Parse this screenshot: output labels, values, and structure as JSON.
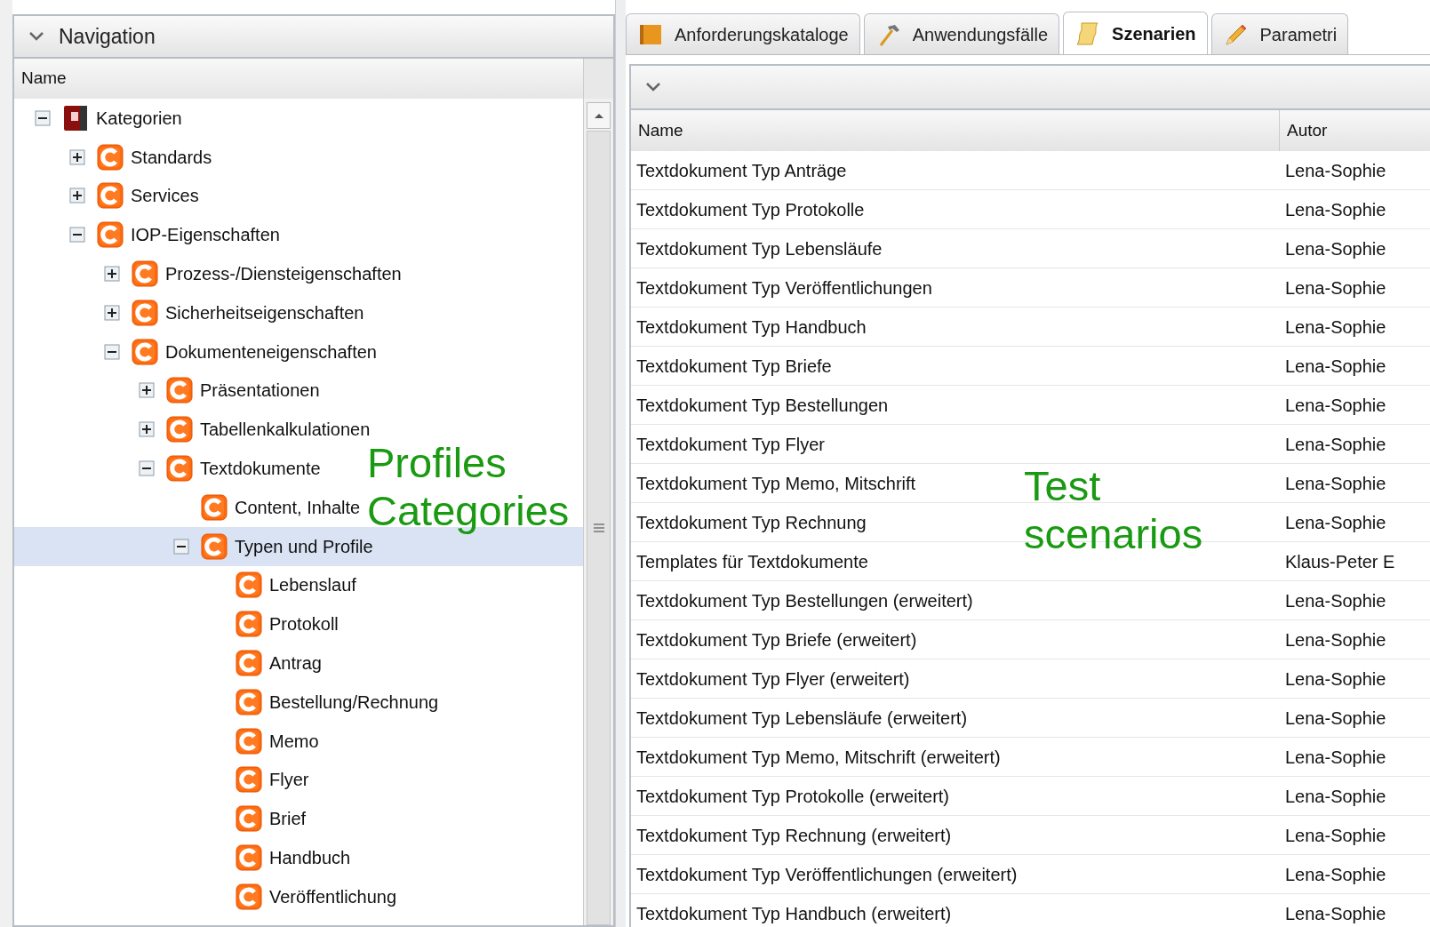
{
  "navigation": {
    "title": "Navigation",
    "expanded": true,
    "column": "Name",
    "tree": [
      {
        "label": "Kategorien",
        "kind": "root",
        "expanded": true,
        "selected": false,
        "children": [
          {
            "label": "Standards",
            "kind": "category",
            "expanded": false,
            "selected": false
          },
          {
            "label": "Services",
            "kind": "category",
            "expanded": false,
            "selected": false
          },
          {
            "label": "IOP-Eigenschaften",
            "kind": "category",
            "expanded": true,
            "selected": false,
            "children": [
              {
                "label": "Prozess-/Diensteigenschaften",
                "kind": "category",
                "expanded": false,
                "selected": false
              },
              {
                "label": "Sicherheitseigenschaften",
                "kind": "category",
                "expanded": false,
                "selected": false
              },
              {
                "label": "Dokumenteneigenschaften",
                "kind": "category",
                "expanded": true,
                "selected": false,
                "children": [
                  {
                    "label": "Präsentationen",
                    "kind": "category",
                    "expanded": false,
                    "selected": false
                  },
                  {
                    "label": "Tabellenkalkulationen",
                    "kind": "category",
                    "expanded": false,
                    "selected": false
                  },
                  {
                    "label": "Textdokumente",
                    "kind": "category",
                    "expanded": true,
                    "selected": false,
                    "children": [
                      {
                        "label": "Content, Inhalte",
                        "kind": "category",
                        "selected": false
                      },
                      {
                        "label": "Typen und Profile",
                        "kind": "category",
                        "expanded": true,
                        "selected": true,
                        "children": [
                          {
                            "label": "Lebenslauf",
                            "kind": "category",
                            "selected": false
                          },
                          {
                            "label": "Protokoll",
                            "kind": "category",
                            "selected": false
                          },
                          {
                            "label": "Antrag",
                            "kind": "category",
                            "selected": false
                          },
                          {
                            "label": "Bestellung/Rechnung",
                            "kind": "category",
                            "selected": false
                          },
                          {
                            "label": "Memo",
                            "kind": "category",
                            "selected": false
                          },
                          {
                            "label": "Flyer",
                            "kind": "category",
                            "selected": false
                          },
                          {
                            "label": "Brief",
                            "kind": "category",
                            "selected": false
                          },
                          {
                            "label": "Handbuch",
                            "kind": "category",
                            "selected": false
                          },
                          {
                            "label": "Veröffentlichung",
                            "kind": "category",
                            "selected": false
                          }
                        ]
                      }
                    ]
                  }
                ]
              }
            ]
          }
        ]
      }
    ]
  },
  "tabs": [
    {
      "label": "Anforderungskataloge",
      "kind": "catalog",
      "selected": false
    },
    {
      "label": "Anwendungsfälle",
      "kind": "hammer",
      "selected": false
    },
    {
      "label": "Szenarien",
      "kind": "scroll",
      "selected": true
    },
    {
      "label": "Parametri",
      "kind": "pencil",
      "selected": false
    }
  ],
  "table": {
    "columns": [
      "Name",
      "Autor"
    ],
    "rows": [
      [
        "Textdokument Typ Anträge",
        "Lena-Sophie"
      ],
      [
        "Textdokument Typ Protokolle",
        "Lena-Sophie"
      ],
      [
        "Textdokument Typ Lebensläufe",
        "Lena-Sophie"
      ],
      [
        "Textdokument Typ Veröffentlichungen",
        "Lena-Sophie"
      ],
      [
        "Textdokument Typ Handbuch",
        "Lena-Sophie"
      ],
      [
        "Textdokument Typ Briefe",
        "Lena-Sophie"
      ],
      [
        "Textdokument Typ Bestellungen",
        "Lena-Sophie"
      ],
      [
        "Textdokument Typ Flyer",
        "Lena-Sophie"
      ],
      [
        "Textdokument Typ Memo, Mitschrift",
        "Lena-Sophie"
      ],
      [
        "Textdokument Typ Rechnung",
        "Lena-Sophie"
      ],
      [
        "Templates für Textdokumente",
        "Klaus-Peter E"
      ],
      [
        "Textdokument Typ Bestellungen (erweitert)",
        "Lena-Sophie"
      ],
      [
        "Textdokument Typ Briefe (erweitert)",
        "Lena-Sophie"
      ],
      [
        "Textdokument Typ Flyer (erweitert)",
        "Lena-Sophie"
      ],
      [
        "Textdokument Typ Lebensläufe (erweitert)",
        "Lena-Sophie"
      ],
      [
        "Textdokument Typ Memo, Mitschrift (erweitert)",
        "Lena-Sophie"
      ],
      [
        "Textdokument Typ Protokolle (erweitert)",
        "Lena-Sophie"
      ],
      [
        "Textdokument Typ Rechnung (erweitert)",
        "Lena-Sophie"
      ],
      [
        "Textdokument Typ Veröffentlichungen (erweitert)",
        "Lena-Sophie"
      ],
      [
        "Textdokument Typ Handbuch (erweitert)",
        "Lena-Sophie"
      ]
    ]
  },
  "annotations": [
    {
      "lines": [
        "Profiles",
        "Categories"
      ]
    },
    {
      "lines": [
        "Test",
        "scenarios"
      ]
    }
  ]
}
